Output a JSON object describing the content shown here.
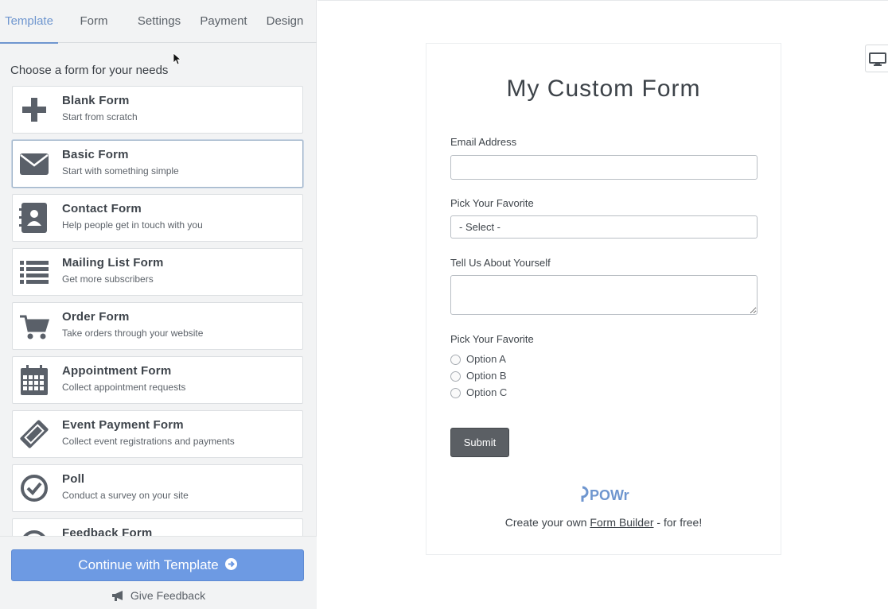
{
  "tabs": [
    {
      "label": "Template"
    },
    {
      "label": "Form"
    },
    {
      "label": "Settings"
    },
    {
      "label": "Payment"
    },
    {
      "label": "Design"
    }
  ],
  "active_tab": "Template",
  "sidebar": {
    "prompt": "Choose a form for your needs",
    "templates": [
      {
        "title": "Blank Form",
        "subtitle": "Start from scratch",
        "icon": "plus-icon"
      },
      {
        "title": "Basic Form",
        "subtitle": "Start with something simple",
        "icon": "envelope-icon"
      },
      {
        "title": "Contact Form",
        "subtitle": "Help people get in touch with you",
        "icon": "contact-book-icon"
      },
      {
        "title": "Mailing List Form",
        "subtitle": "Get more subscribers",
        "icon": "list-icon"
      },
      {
        "title": "Order Form",
        "subtitle": "Take orders through your website",
        "icon": "cart-icon"
      },
      {
        "title": "Appointment Form",
        "subtitle": "Collect appointment requests",
        "icon": "calendar-icon"
      },
      {
        "title": "Event Payment Form",
        "subtitle": "Collect event registrations and payments",
        "icon": "ticket-icon"
      },
      {
        "title": "Poll",
        "subtitle": "Conduct a survey on your site",
        "icon": "check-circle-icon"
      },
      {
        "title": "Feedback Form",
        "subtitle": "",
        "icon": "feedback-icon"
      }
    ],
    "selected_template": "Basic Form",
    "continue_label": "Continue with Template",
    "feedback_label": "Give Feedback"
  },
  "preview": {
    "form_title": "My Custom Form",
    "email_label": "Email Address",
    "email_value": "",
    "pick_label": "Pick Your Favorite",
    "select_value": "- Select -",
    "about_label": "Tell Us About Yourself",
    "about_value": "",
    "radio_label": "Pick Your Favorite",
    "radio_options": [
      "Option A",
      "Option B",
      "Option C"
    ],
    "submit_label": "Submit",
    "logo_text": "POWr",
    "footer_before": "Create your own ",
    "footer_link": "Form Builder",
    "footer_after": " - for free!"
  },
  "colors": {
    "accent": "#6f96cf",
    "continue_button": "#6d9ae3",
    "submit_button": "#5b5f64",
    "logo": "#6f96cf"
  }
}
